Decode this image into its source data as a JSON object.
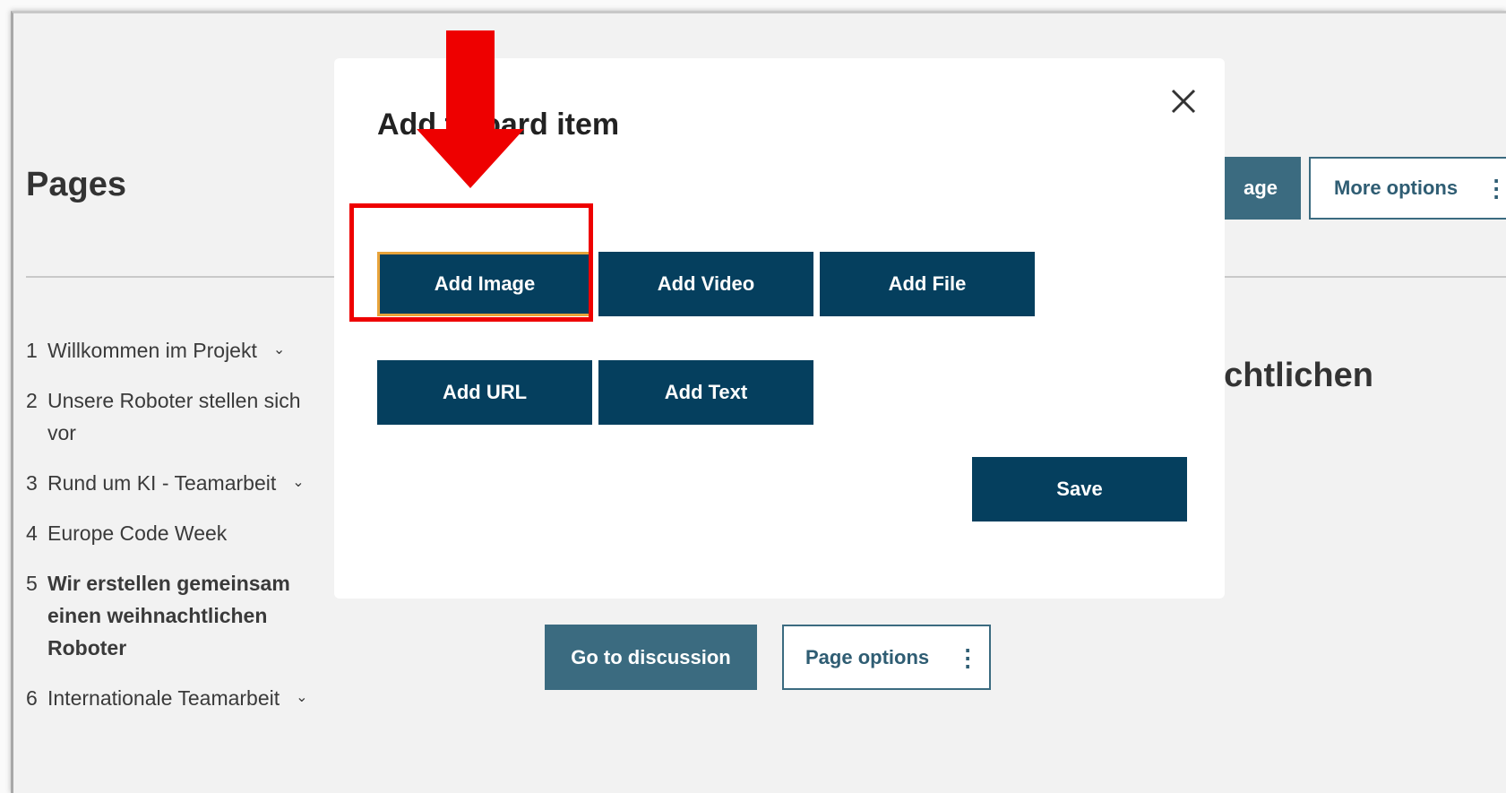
{
  "page": {
    "title": "Pages",
    "new_page_button_visible": "age",
    "more_options_button": "More options",
    "heading_partial": "achtlichen",
    "nav_items": [
      {
        "num": "1",
        "label": "Willkommen im Projekt",
        "has_chevron": true
      },
      {
        "num": "2",
        "label": "Unsere Roboter stellen sich vor",
        "has_chevron": false
      },
      {
        "num": "3",
        "label": "Rund um KI - Teamarbeit",
        "has_chevron": true
      },
      {
        "num": "4",
        "label": "Europe Code Week",
        "has_chevron": false
      },
      {
        "num": "5",
        "label": "Wir erstellen gemeinsam einen weihnachtlichen Roboter",
        "has_chevron": false,
        "active": true
      },
      {
        "num": "6",
        "label": "Internationale Teamarbeit",
        "has_chevron": true
      }
    ],
    "go_to_discussion_button": "Go to discussion",
    "page_options_button": "Page options"
  },
  "modal": {
    "title": "Add t    board item",
    "close_icon": "close-icon",
    "buttons": {
      "add_image": "Add Image",
      "add_video": "Add Video",
      "add_file": "Add File",
      "add_url": "Add URL",
      "add_text": "Add Text",
      "save": "Save"
    }
  },
  "colors": {
    "primary": "#053f5e",
    "secondary": "#3b6b80",
    "focus_outline": "#e8a33a",
    "annotation": "#ee0000"
  }
}
